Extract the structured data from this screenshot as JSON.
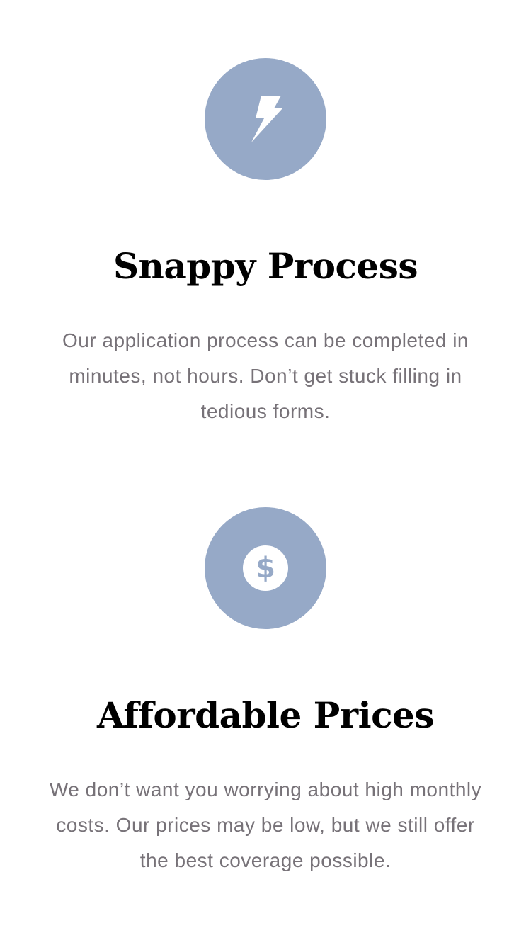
{
  "colors": {
    "icon_circle": "#96a9c7",
    "icon_glyph": "#ffffff",
    "title": "#000000",
    "body_text": "#777278"
  },
  "features": [
    {
      "icon": "lightning-bolt-icon",
      "title": "Snappy Process",
      "description": "Our application process can be completed in minutes, not hours. Don’t get stuck filling in tedious forms."
    },
    {
      "icon": "dollar-coin-icon",
      "title": "Affordable Prices",
      "description": "We don’t want you worrying about high monthly costs. Our prices may be low, but we still offer the best coverage possible."
    }
  ]
}
